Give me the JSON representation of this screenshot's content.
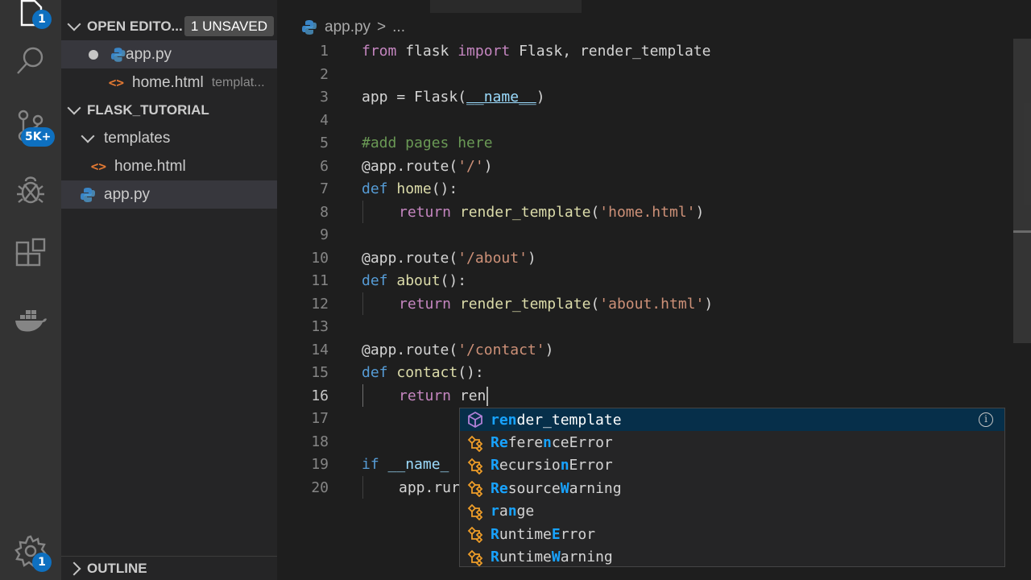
{
  "activity_bar": {
    "explorer_badge": "1",
    "source_control_badge": "5K+",
    "settings_badge": "1"
  },
  "sidebar": {
    "open_editors_title": "OPEN EDITO...",
    "unsaved_label": "1 UNSAVED",
    "open_editors": [
      {
        "name": "app.py",
        "detail": ""
      },
      {
        "name": "home.html",
        "detail": "templat..."
      }
    ],
    "project_title": "FLASK_TUTORIAL",
    "tree": [
      {
        "name": "templates"
      },
      {
        "name": "home.html"
      },
      {
        "name": "app.py"
      }
    ],
    "outline_title": "OUTLINE"
  },
  "editor": {
    "breadcrumb_file": "app.py",
    "breadcrumb_sep": ">",
    "breadcrumb_more": "...",
    "line_numbers": [
      "1",
      "2",
      "3",
      "4",
      "5",
      "6",
      "7",
      "8",
      "9",
      "10",
      "11",
      "12",
      "13",
      "14",
      "15",
      "16",
      "17",
      "18",
      "19",
      "20"
    ],
    "current_line": 16,
    "tokens": {
      "l1": [
        "from",
        " flask ",
        "import",
        " Flask, render_template"
      ],
      "l3": [
        "app = Flask(",
        "__name__",
        ")"
      ],
      "l5": [
        "#add pages here"
      ],
      "l6": [
        "@app.route(",
        "'/'",
        ")"
      ],
      "l7": [
        "def",
        " ",
        "home",
        "():"
      ],
      "l8": [
        "return",
        " ",
        "render_template",
        "(",
        "'home.html'",
        ")"
      ],
      "l10": [
        "@app.route(",
        "'/about'",
        ")"
      ],
      "l11": [
        "def",
        " ",
        "about",
        "():"
      ],
      "l12": [
        "return",
        " ",
        "render_template",
        "(",
        "'about.html'",
        ")"
      ],
      "l14": [
        "@app.route(",
        "'/contact'",
        ")"
      ],
      "l15": [
        "def",
        " ",
        "contact",
        "():"
      ],
      "l16": [
        "return",
        " ren"
      ],
      "l19": [
        "if",
        " ",
        "__name_"
      ],
      "l20": [
        "app.rur"
      ]
    }
  },
  "suggest": {
    "items": [
      {
        "hl1": "ren",
        "rest1": "der_template",
        "hl2": "",
        "rest2": "",
        "kind": "method-icon"
      },
      {
        "hl1": "Re",
        "rest1": "fere",
        "hl2": "n",
        "rest2": "ceError",
        "kind": "class-icon"
      },
      {
        "hl1": "R",
        "rest1": "ecursio",
        "hl2": "n",
        "rest2": "Error",
        "kind": "class-icon"
      },
      {
        "hl1": "Re",
        "rest1": "source",
        "hl2": "W",
        "rest2": "arning",
        "kind": "class-icon"
      },
      {
        "hl1": "r",
        "rest1": "a",
        "hl2": "n",
        "rest2": "ge",
        "kind": "class-icon"
      },
      {
        "hl1": "R",
        "rest1": "untime",
        "hl2": "E",
        "rest2": "rror",
        "kind": "class-icon"
      },
      {
        "hl1": "R",
        "rest1": "untime",
        "hl2": "W",
        "rest2": "arning",
        "kind": "class-icon"
      }
    ],
    "info_label": "i"
  },
  "colors": {
    "accent": "#0e70c0",
    "match_highlight": "#18a3ff",
    "selection": "#062f4a"
  }
}
